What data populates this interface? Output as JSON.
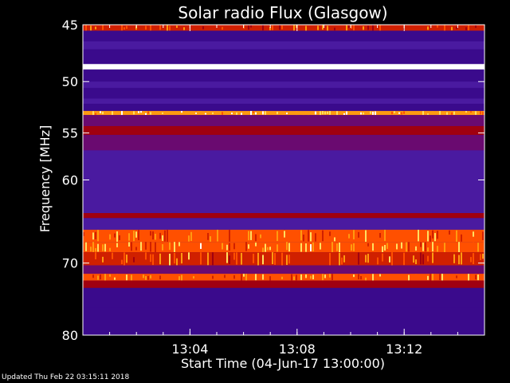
{
  "chart_data": {
    "type": "heatmap",
    "title": "Solar radio Flux (Glasgow)",
    "xlabel": "Start Time (04-Jun-17 13:00:00)",
    "ylabel": "Frequency [MHz]",
    "xlim": [
      "13:00",
      "13:15"
    ],
    "x_ticks": [
      "13:04",
      "13:08",
      "13:12"
    ],
    "y_scale": "log",
    "y_ticks": [
      45,
      50,
      55,
      60,
      70,
      80
    ],
    "ylim": [
      80,
      45
    ],
    "colormap": [
      "#2a0050",
      "#3a0a8c",
      "#4a1aa0",
      "#6a0a70",
      "#a00010",
      "#d02000",
      "#ff5000",
      "#ff9a10",
      "#ffe060",
      "#ffffff"
    ],
    "bands": [
      {
        "f0": 45.0,
        "f1": 45.5,
        "level": 0.55
      },
      {
        "f0": 45.5,
        "f1": 46.4,
        "level": 0.08
      },
      {
        "f0": 46.4,
        "f1": 47.1,
        "level": 0.18
      },
      {
        "f0": 47.1,
        "f1": 48.4,
        "level": 0.06
      },
      {
        "f0": 48.4,
        "f1": 48.9,
        "level": 0.95
      },
      {
        "f0": 48.9,
        "f1": 50.0,
        "level": 0.1
      },
      {
        "f0": 50.0,
        "f1": 50.6,
        "level": 0.25
      },
      {
        "f0": 50.6,
        "f1": 51.6,
        "level": 0.12
      },
      {
        "f0": 51.6,
        "f1": 52.1,
        "level": 0.22
      },
      {
        "f0": 52.1,
        "f1": 52.8,
        "level": 0.1
      },
      {
        "f0": 52.8,
        "f1": 53.2,
        "level": 0.75
      },
      {
        "f0": 53.2,
        "f1": 54.3,
        "level": 0.35
      },
      {
        "f0": 54.3,
        "f1": 55.2,
        "level": 0.48
      },
      {
        "f0": 55.2,
        "f1": 56.8,
        "level": 0.3
      },
      {
        "f0": 56.8,
        "f1": 63.8,
        "level": 0.2
      },
      {
        "f0": 63.8,
        "f1": 64.4,
        "level": 0.45
      },
      {
        "f0": 64.4,
        "f1": 65.8,
        "level": 0.22
      },
      {
        "f0": 65.8,
        "f1": 67.3,
        "level": 0.62
      },
      {
        "f0": 67.3,
        "f1": 68.6,
        "level": 0.68
      },
      {
        "f0": 68.6,
        "f1": 70.3,
        "level": 0.58
      },
      {
        "f0": 70.3,
        "f1": 71.4,
        "level": 0.3
      },
      {
        "f0": 71.4,
        "f1": 72.3,
        "level": 0.64
      },
      {
        "f0": 72.3,
        "f1": 73.3,
        "level": 0.4
      },
      {
        "f0": 73.3,
        "f1": 76.0,
        "level": 0.15
      },
      {
        "f0": 76.0,
        "f1": 80.0,
        "level": 0.13
      }
    ]
  },
  "footer": {
    "updated": "Updated Thu Feb 22 03:15:11 2018"
  }
}
